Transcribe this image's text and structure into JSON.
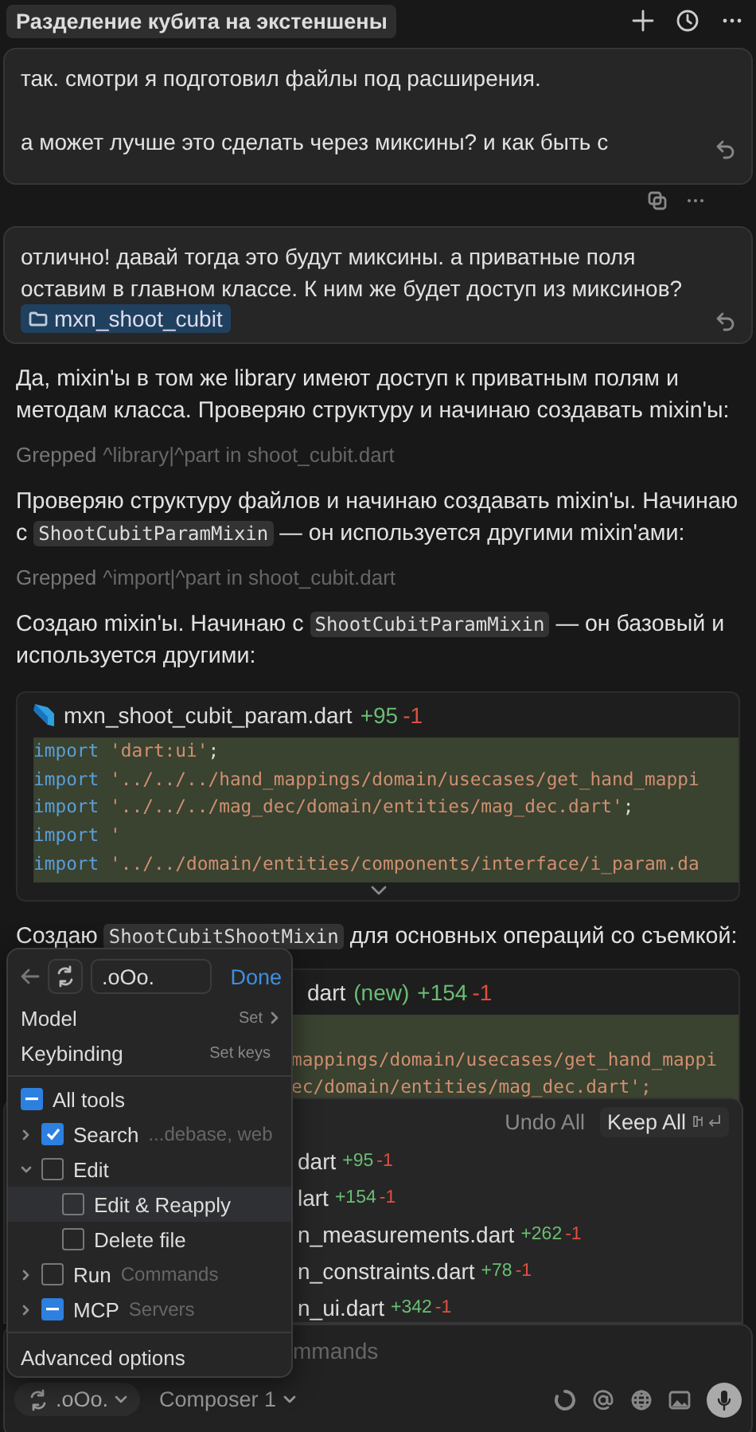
{
  "header": {
    "title": "Разделение кубита на экстеншены"
  },
  "messages": [
    {
      "lines": [
        "так. смотри я подготовил файлы под расширения.",
        "а может лучше это сделать через миксины? и как быть с"
      ]
    },
    {
      "lines": [
        "отлично! давай тогда это будут миксины. а приватные поля оставим в главном классе. К ним же будет доступ из миксинов?"
      ],
      "chip": "mxn_shoot_cubit"
    }
  ],
  "assistant": [
    {
      "kind": "paragraph",
      "parts": [
        {
          "text": "Да, mixin'ы в том же library имеют доступ к приватным полям и методам класса. Проверяю структуру и начинаю создавать mixin'ы:"
        }
      ]
    },
    {
      "kind": "grep",
      "label": "Grepped",
      "detail": "^library|^part in shoot_cubit.dart"
    },
    {
      "kind": "paragraph",
      "parts": [
        {
          "text": "Проверяю структуру файлов и начинаю создавать mixin'ы. Начинаю с "
        },
        {
          "code": "ShootCubitParamMixin"
        },
        {
          "text": " — он используется другими mixin'ами:"
        }
      ]
    },
    {
      "kind": "grep",
      "label": "Grepped",
      "detail": "^import|^part in shoot_cubit.dart"
    },
    {
      "kind": "paragraph",
      "parts": [
        {
          "text": "Создаю mixin'ы. Начинаю с "
        },
        {
          "code": "ShootCubitParamMixin"
        },
        {
          "text": " — он базовый и используется другими:"
        }
      ]
    },
    {
      "kind": "code",
      "file": "mxn_shoot_cubit_param.dart",
      "added": "+95",
      "removed": "-1",
      "lines": [
        {
          "keyword": "import",
          "string": "'dart:ui'",
          "end": ";"
        },
        {
          "keyword": "import",
          "string": "'../../../hand_mappings/domain/usecases/get_hand_mappi"
        },
        {
          "keyword": "import",
          "string": "'../../../mag_dec/domain/entities/mag_dec.dart'",
          "end": ";"
        },
        {
          "keyword": "import",
          "string": "'"
        },
        {
          "keyword": "import",
          "string": "'../../domain/entities/components/interface/i_param.da"
        }
      ]
    },
    {
      "kind": "paragraph",
      "parts": [
        {
          "text": "Создаю "
        },
        {
          "code": "ShootCubitShootMixin"
        },
        {
          "text": " для основных операций со съемкой:"
        }
      ]
    },
    {
      "kind": "partial-code",
      "file": "dart",
      "tag": "(new)",
      "added": "+154",
      "removed": "-1",
      "lines": [
        "mappings/domain/usecases/get_hand_mappi",
        "ec/domain/entities/mag_dec.dart';"
      ]
    }
  ],
  "changes": {
    "undo": "Undo All",
    "keep": "Keep All",
    "files": [
      {
        "name": "dart",
        "added": "+95",
        "removed": "-1"
      },
      {
        "name": "lart",
        "added": "+154",
        "removed": "-1"
      },
      {
        "name": "n_measurements.dart",
        "added": "+262",
        "removed": "-1"
      },
      {
        "name": "n_constraints.dart",
        "added": "+78",
        "removed": "-1"
      },
      {
        "name": "n_ui.dart",
        "added": "+342",
        "removed": "-1"
      }
    ]
  },
  "composer": {
    "placeholder": "mmands",
    "agent": ".oOo.",
    "mode": "Composer 1"
  },
  "popup": {
    "search_value": ".oOo.",
    "done": "Done",
    "settings": [
      {
        "label": "Model",
        "value": "Set",
        "arrow": true
      },
      {
        "label": "Keybinding",
        "value": "Set keys",
        "arrow": false
      }
    ],
    "all_tools": {
      "label": "All tools",
      "mixed": true
    },
    "tools": [
      {
        "label": "Search",
        "hint": "...debase, web",
        "checked": true,
        "mixed": false,
        "expanded": false,
        "selected": false
      },
      {
        "label": "Edit",
        "checked": false,
        "mixed": false,
        "expanded": true,
        "selected": false,
        "children": [
          {
            "label": "Edit & Reapply",
            "checked": false,
            "mixed": false,
            "selected": true
          },
          {
            "label": "Delete file",
            "checked": false,
            "mixed": false,
            "selected": false
          }
        ]
      },
      {
        "label": "Run",
        "hint": "Commands",
        "checked": false,
        "mixed": false,
        "expanded": false,
        "selected": false
      },
      {
        "label": "MCP",
        "hint": "Servers",
        "mixed": true,
        "expanded": false,
        "selected": false
      }
    ],
    "advanced": "Advanced options"
  }
}
